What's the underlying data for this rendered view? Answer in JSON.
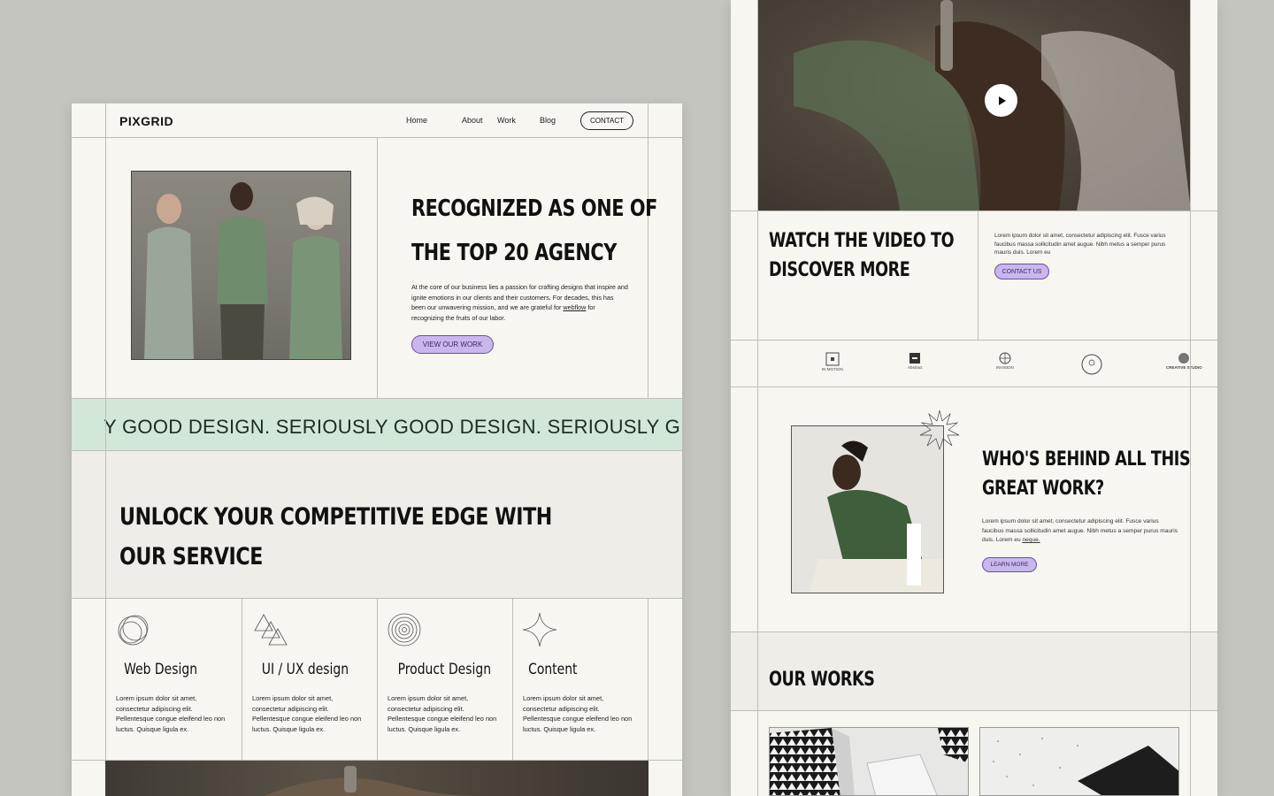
{
  "brand": {
    "logo": "PIXGRID"
  },
  "nav": {
    "items": [
      "Home",
      "About",
      "Work",
      "Blog"
    ],
    "contact_label": "CONTACT"
  },
  "hero": {
    "title_line1": "RECOGNIZED AS ONE OF",
    "title_line2": "THE TOP 20 AGENCY",
    "text_before_link": "At the core of our business lies a passion for crafting designs that inspire and ignite emotions in our clients and their customers. For decades, this has been our unwavering mission, and we are grateful for ",
    "text_link": "webflow",
    "text_after_link": " for recognizing the fruits of our labor.",
    "cta_label": "VIEW OUR WORK"
  },
  "marquee": {
    "text": "Y GOOD DESIGN.  SERIOUSLY GOOD DESIGN.  SERIOUSLY G"
  },
  "services": {
    "title_line1": "UNLOCK YOUR COMPETITIVE EDGE WITH",
    "title_line2": "OUR SERVICE",
    "items": [
      {
        "name": "Web Design",
        "desc": "Lorem ipsum dolor sit amet, consectetur adipiscing elit. Pellentesque congue eleifend leo non luctus. Quisque ligula ex."
      },
      {
        "name": "UI / UX design",
        "desc": "Lorem ipsum dolor sit amet, consectetur adipiscing elit. Pellentesque congue eleifend leo non luctus. Quisque ligula ex."
      },
      {
        "name": "Product Design",
        "desc": "Lorem ipsum dolor sit amet, consectetur adipiscing elit. Pellentesque congue eleifend leo non luctus. Quisque ligula ex."
      },
      {
        "name": "Content",
        "desc": "Lorem ipsum dolor sit amet, consectetur adipiscing elit. Pellentesque congue eleifend leo non luctus. Quisque ligula ex."
      }
    ]
  },
  "video": {
    "title_line1": "WATCH THE VIDEO TO",
    "title_line2": "DISCOVER MORE",
    "text": "Lorem ipsum dolor sit amet, consectetur adipiscing elit. Fusce varius faucibus massa sollicitudin amet augue. Nibh metus a semper purus mauris duis. Lorem eu",
    "cta_label": "CONTACT US"
  },
  "logos": [
    "IN MOTION",
    "Abstract",
    "INVISION",
    "",
    "CREATIVE STUDIO"
  ],
  "about": {
    "title_line1": "WHO'S BEHIND ALL THIS",
    "title_line2": "GREAT WORK?",
    "text_before_link": "Lorem ipsum dolor sit amet, consectetur adipiscing elit. Fusce varius faucibus massa sollicitudin amet augue. Nibh metus a semper purus mauris duis. Lorem eu ",
    "text_link": "neque.",
    "cta_label": "LEARN MORE"
  },
  "works": {
    "title": "OUR WORKS"
  },
  "colors": {
    "accent_pill": "#c8b6ec",
    "marquee_bg": "#d3e7d9",
    "page_bg": "#f7f6f1",
    "backdrop": "#c5c5bf"
  }
}
